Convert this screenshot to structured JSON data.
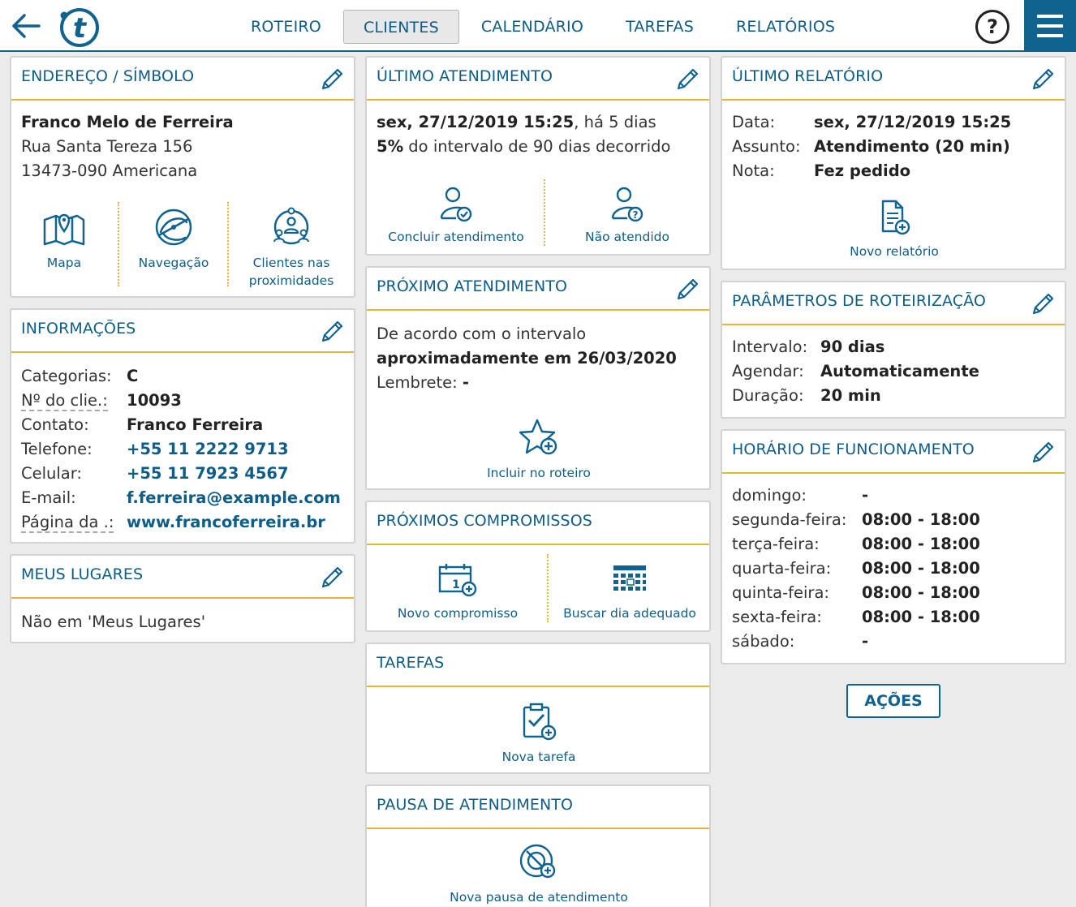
{
  "nav": {
    "tabs": [
      "ROTEIRO",
      "CLIENTES",
      "CALENDÁRIO",
      "TAREFAS",
      "RELATÓRIOS"
    ],
    "active_tab": "CLIENTES",
    "help_label": "?",
    "logo_letter": "t"
  },
  "colors": {
    "accent": "#10628f",
    "link": "#0e5d87",
    "divider": "#e8b53a",
    "background": "#ebebeb"
  },
  "address": {
    "title": "ENDEREÇO / SÍMBOLO",
    "name": "Franco Melo de Ferreira",
    "street": "Rua Santa Tereza 156",
    "city": "13473-090 Americana",
    "actions": [
      "Mapa",
      "Navegação",
      "Clientes nas",
      "proximidades"
    ]
  },
  "info": {
    "title": "INFORMAÇÕES",
    "rows": [
      {
        "label": "Categorias:",
        "value": "C"
      },
      {
        "label": "Nº do clie.:",
        "value": "10093"
      },
      {
        "label": "Contato:",
        "value": "Franco Ferreira"
      },
      {
        "label": "Telefone:",
        "value": "+55 11 2222 9713"
      },
      {
        "label": "Celular:",
        "value": "+55 11 7923 4567"
      },
      {
        "label": "E-mail:",
        "value": "f.ferreira@example.com"
      },
      {
        "label": "Página da .:",
        "value": "www.francoferreira.br"
      }
    ]
  },
  "places": {
    "title": "MEUS LUGARES",
    "text": "Não em 'Meus Lugares'"
  },
  "last_visit": {
    "title": "ÚLTIMO ATENDIMENTO",
    "date": "sex, 27/12/2019 15:25",
    "ago": ", há 5 dias",
    "percent": "5%",
    "interval_text": " do intervalo de 90 dias decorrido",
    "actions": [
      "Concluir atendimento",
      "Não atendido"
    ]
  },
  "next_visit": {
    "title": "PRÓXIMO ATENDIMENTO",
    "line1": "De acordo com o intervalo",
    "line2": "aproximadamente em 26/03/2020",
    "reminder_label": "Lembrete: ",
    "reminder_value": "-",
    "action": "Incluir no roteiro"
  },
  "appointments": {
    "title": "PRÓXIMOS COMPROMISSOS",
    "actions": [
      "Novo compromisso",
      "Buscar dia adequado"
    ]
  },
  "tasks": {
    "title": "TAREFAS",
    "action": "Nova tarefa"
  },
  "pause": {
    "title": "PAUSA DE ATENDIMENTO",
    "action": "Nova pausa de atendimento"
  },
  "last_report": {
    "title": "ÚLTIMO RELATÓRIO",
    "rows": [
      {
        "label": "Data:",
        "value": "sex, 27/12/2019 15:25"
      },
      {
        "label": "Assunto:",
        "value": "Atendimento (20 min)"
      },
      {
        "label": "Nota:",
        "value": "Fez pedido"
      }
    ],
    "action": "Novo relatório"
  },
  "routing": {
    "title": "PARÂMETROS DE ROTEIRIZAÇÃO",
    "rows": [
      {
        "label": "Intervalo:",
        "value": "90 dias"
      },
      {
        "label": "Agendar:",
        "value": "Automaticamente"
      },
      {
        "label": "Duração:",
        "value": "20 min"
      }
    ]
  },
  "hours": {
    "title": "HORÁRIO DE FUNCIONAMENTO",
    "rows": [
      {
        "label": "domingo:",
        "value": "-"
      },
      {
        "label": "segunda-feira:",
        "value": "08:00 - 18:00"
      },
      {
        "label": "terça-feira:",
        "value": "08:00 - 18:00"
      },
      {
        "label": "quarta-feira:",
        "value": "08:00 - 18:00"
      },
      {
        "label": "quinta-feira:",
        "value": "08:00 - 18:00"
      },
      {
        "label": "sexta-feira:",
        "value": "08:00 - 18:00"
      },
      {
        "label": "sábado:",
        "value": "-"
      }
    ]
  },
  "actions_button": "AÇÕES"
}
